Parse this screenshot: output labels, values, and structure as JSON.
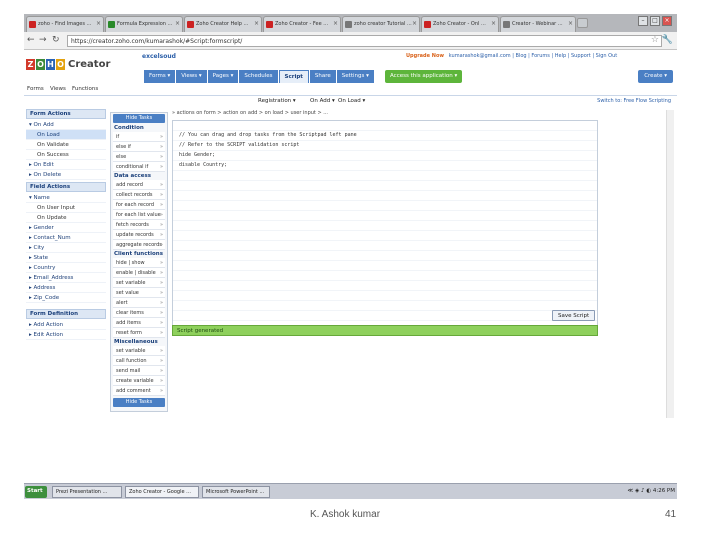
{
  "browser": {
    "tabs": [
      {
        "label": "zoho - Find Images ...",
        "fav": "#cc2222"
      },
      {
        "label": "Formula Expression ...",
        "fav": "#2a8a2a"
      },
      {
        "label": "Zoho Creator Help ...",
        "fav": "#cc2222"
      },
      {
        "label": "Zoho Creator - Fee ...",
        "fav": "#cc2222"
      },
      {
        "label": "zoho creator Tutorial ...",
        "fav": "#777777"
      },
      {
        "label": "Zoho Creator - Onl ...",
        "fav": "#cc2222"
      },
      {
        "label": "Creator - Webinar ...",
        "fav": "#777777"
      }
    ],
    "url": "https://creator.zoho.com/kumarashok/#Script:formscript/",
    "window_controls": [
      "–",
      "□",
      "×"
    ]
  },
  "app": {
    "logo_letters": [
      "Z",
      "O",
      "H",
      "O"
    ],
    "logo_colors": [
      "#d23a2b",
      "#3b8a3a",
      "#2a63b6",
      "#e3a20f"
    ],
    "product": "Creator",
    "app_name": "excelsoud",
    "upgrade": "Upgrade Now",
    "top_links": "kumarashok@gmail.com  |  Blog  |  Forums  |  Help  |  Support  |  Sign Out",
    "main_tabs": [
      "Forms ▾",
      "Views ▾",
      "Pages ▾",
      "Schedules",
      "Script",
      "Share",
      "Settings ▾"
    ],
    "active_tab": "Script",
    "access_button": "Access this application ▾",
    "create_button": "Create ▾",
    "sub_nav": [
      "Forms",
      "Views",
      "Functions"
    ]
  },
  "toolbar": {
    "form_select": "Registration ▾",
    "action_select": "On Add ▾",
    "event_select": "On Load ▾",
    "switch_links": "Switch to:  Free Flow Scripting"
  },
  "left_panel": {
    "form_actions_title": "Form Actions",
    "form_actions": [
      {
        "label": "▾ On Add",
        "indent": false
      },
      {
        "label": "On Load",
        "indent": true
      },
      {
        "label": "On Validate",
        "indent": true
      },
      {
        "label": "On Success",
        "indent": true
      },
      {
        "label": "▸ On Edit",
        "indent": false
      },
      {
        "label": "▸ On Delete",
        "indent": false
      }
    ],
    "field_actions_title": "Field Actions",
    "field_actions": [
      {
        "label": "▾ Name",
        "indent": false
      },
      {
        "label": "On User Input",
        "indent": true
      },
      {
        "label": "On Update",
        "indent": true
      },
      {
        "label": "▸ Gender",
        "indent": false
      },
      {
        "label": "▸ Contact_Num",
        "indent": false
      },
      {
        "label": "▸ City",
        "indent": false
      },
      {
        "label": "▸ State",
        "indent": false
      },
      {
        "label": "▸ Country",
        "indent": false
      },
      {
        "label": "▸ Email_Address",
        "indent": false
      },
      {
        "label": "▸ Address",
        "indent": false
      },
      {
        "label": "▸ Zip_Code",
        "indent": false
      }
    ],
    "form_def_title": "Form Definition",
    "form_def": [
      {
        "label": "▸ Add Action",
        "indent": false
      },
      {
        "label": "▸ Edit Action",
        "indent": false
      }
    ]
  },
  "mid_panel": {
    "button_top": "Hide Tasks",
    "button_bottom": "Hide Tasks",
    "sections": [
      {
        "title": "Condition",
        "items": [
          "if",
          "else if",
          "else",
          "conditional if"
        ]
      },
      {
        "title": "Data access",
        "items": [
          "add record",
          "collect records",
          "for each record",
          "for each list value",
          "fetch records",
          "update records",
          "aggregate records"
        ]
      },
      {
        "title": "Client functions",
        "items": [
          "hide | show",
          "enable | disable",
          "set variable",
          "set value",
          "alert",
          "clear items",
          "add items",
          "reset form"
        ]
      },
      {
        "title": "Miscellaneous",
        "items": [
          "set variable",
          "call function",
          "send mail",
          "create variable",
          "add comment"
        ]
      }
    ]
  },
  "editor": {
    "path": "» actions on form > action on add > on load > user input > ...",
    "lines": [
      "// You can drag and drop tasks from the Scriptpad left pane",
      "// Refer to the SCRIPT validation script",
      "hide Gender;",
      "disable Country;"
    ],
    "save_button": "Save Script",
    "status": "Script generated"
  },
  "taskbar": {
    "start": "Start",
    "items": [
      "Prezi Presentation ...",
      "Zoho Creator - Google ...",
      "Microsoft PowerPoint ..."
    ],
    "tray": "≪  ◈ ♪ ◐  4:26 PM"
  },
  "slide": {
    "author": "K. Ashok kumar",
    "page": "41"
  }
}
